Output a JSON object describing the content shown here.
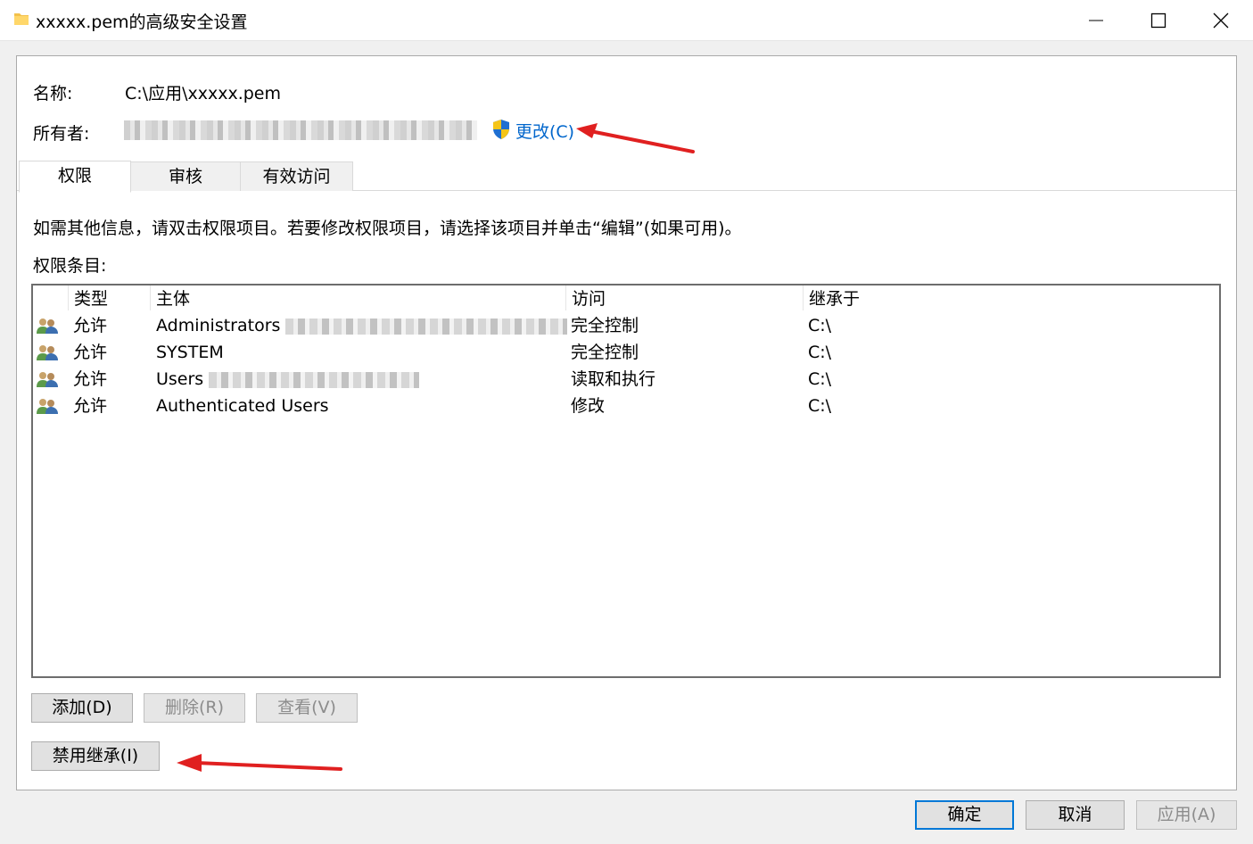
{
  "window": {
    "title": "xxxxx.pem的高级安全设置",
    "icon": "folder-icon",
    "controls": [
      "minimize-icon",
      "maximize-icon",
      "close-icon"
    ]
  },
  "name_label": "名称:",
  "name_value": "C:\\应用\\xxxxx.pem",
  "owner_label": "所有者:",
  "change_link": "更改(C)",
  "tabs": [
    {
      "label": "权限",
      "active": true
    },
    {
      "label": "审核",
      "active": false
    },
    {
      "label": "有效访问",
      "active": false
    }
  ],
  "info_text": "如需其他信息，请双击权限项目。若要修改权限项目，请选择该项目并单击“编辑”(如果可用)。",
  "entries_label": "权限条目:",
  "columns": [
    "类型",
    "主体",
    "访问",
    "继承于"
  ],
  "rows": [
    {
      "type": "允许",
      "principal": "Administrators",
      "access": "完全控制",
      "inherited": "C:\\"
    },
    {
      "type": "允许",
      "principal": "SYSTEM",
      "access": "完全控制",
      "inherited": "C:\\"
    },
    {
      "type": "允许",
      "principal": "Users",
      "access": "读取和执行",
      "inherited": "C:\\"
    },
    {
      "type": "允许",
      "principal": "Authenticated Users",
      "access": "修改",
      "inherited": "C:\\"
    }
  ],
  "buttons": {
    "add": "添加(D)",
    "remove": "删除(R)",
    "view": "查看(V)",
    "disable_inheritance": "禁用继承(I)",
    "ok": "确定",
    "cancel": "取消",
    "apply": "应用(A)"
  },
  "colors": {
    "link": "#0066cc",
    "annotation_arrow": "#e02020",
    "focus": "#0078d7"
  }
}
